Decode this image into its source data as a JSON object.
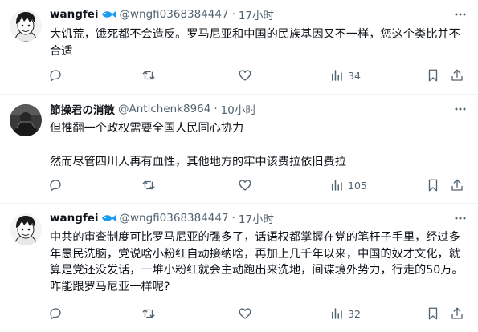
{
  "tweets": [
    {
      "name": "wangfei",
      "handle": "@wngfi0368384447",
      "separator": "·",
      "time": "17小时",
      "paragraphs": [
        "大饥荒，饿死都不会造反。罗马尼亚和中国的民族基因又不一样，您这个类比并不合适"
      ],
      "views": "34",
      "avatar": "anime-boy-avatar",
      "badge": "fish-emoji-icon"
    },
    {
      "name": "節操君の消散",
      "handle": "@Antichenk8964",
      "separator": "·",
      "time": "10小时",
      "paragraphs": [
        "但推翻一个政权需要全国人民同心协力",
        "然而尽管四川人再有血性，其他地方的牢中该费拉依旧费拉"
      ],
      "views": "105",
      "avatar": "dark-figure-avatar"
    },
    {
      "name": "wangfei",
      "handle": "@wngfi0368384447",
      "separator": "·",
      "time": "17小时",
      "paragraphs": [
        "中共的审查制度可比罗马尼亚的强多了，话语权都掌握在党的笔杆子手里，经过多年愚民洗脑，党说啥小粉红自动接纳啥，再加上几千年以来，中国的奴才文化，就算是党还没发话，一堆小粉红就会主动跑出来洗地，间谍境外势力，行走的50万。咋能跟罗马尼亚一样呢?"
      ],
      "views": "32",
      "avatar": "anime-boy-avatar",
      "badge": "fish-emoji-icon"
    }
  ],
  "icons": [
    "reply-icon",
    "retweet-icon",
    "like-icon",
    "views-icon",
    "bookmark-icon",
    "share-icon",
    "more-icon"
  ],
  "colors": {
    "text": "#0f1419",
    "secondary": "#536471",
    "divider": "#eff3f4",
    "fish": "#1d9bf0"
  }
}
